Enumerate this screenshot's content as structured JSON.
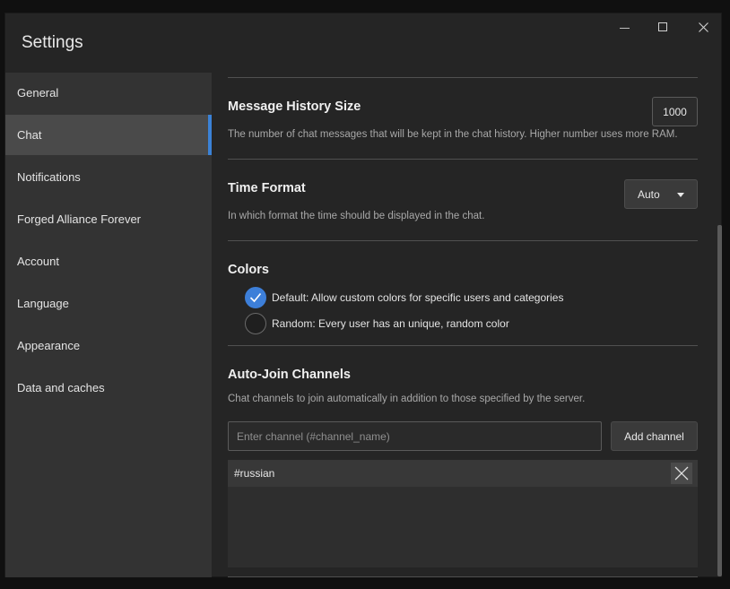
{
  "window": {
    "title": "Settings"
  },
  "sidebar": {
    "items": [
      {
        "label": "General"
      },
      {
        "label": "Chat"
      },
      {
        "label": "Notifications"
      },
      {
        "label": "Forged Alliance Forever"
      },
      {
        "label": "Account"
      },
      {
        "label": "Language"
      },
      {
        "label": "Appearance"
      },
      {
        "label": "Data and caches"
      }
    ],
    "active": "Chat"
  },
  "history": {
    "title": "Message History Size",
    "description": "The number of chat messages that will be kept in the chat history. Higher number uses more RAM.",
    "value": "1000"
  },
  "time_format": {
    "title": "Time Format",
    "description": "In which format the time should be displayed in the chat.",
    "selected": "Auto"
  },
  "colors": {
    "title": "Colors",
    "options": [
      {
        "label": "Default: Allow custom colors for specific users and categories",
        "checked": true
      },
      {
        "label": "Random: Every user has an unique, random color",
        "checked": false
      }
    ]
  },
  "auto_join": {
    "title": "Auto-Join Channels",
    "description": "Chat channels to join automatically in addition to those specified by the server.",
    "input_placeholder": "Enter channel (#channel_name)",
    "add_button": "Add channel",
    "channels": [
      "#russian"
    ]
  },
  "colors_theme": {
    "accent": "#3b82d6",
    "background": "#252525",
    "sidebar": "#333333",
    "sidebar_active": "#4a4a4a"
  }
}
